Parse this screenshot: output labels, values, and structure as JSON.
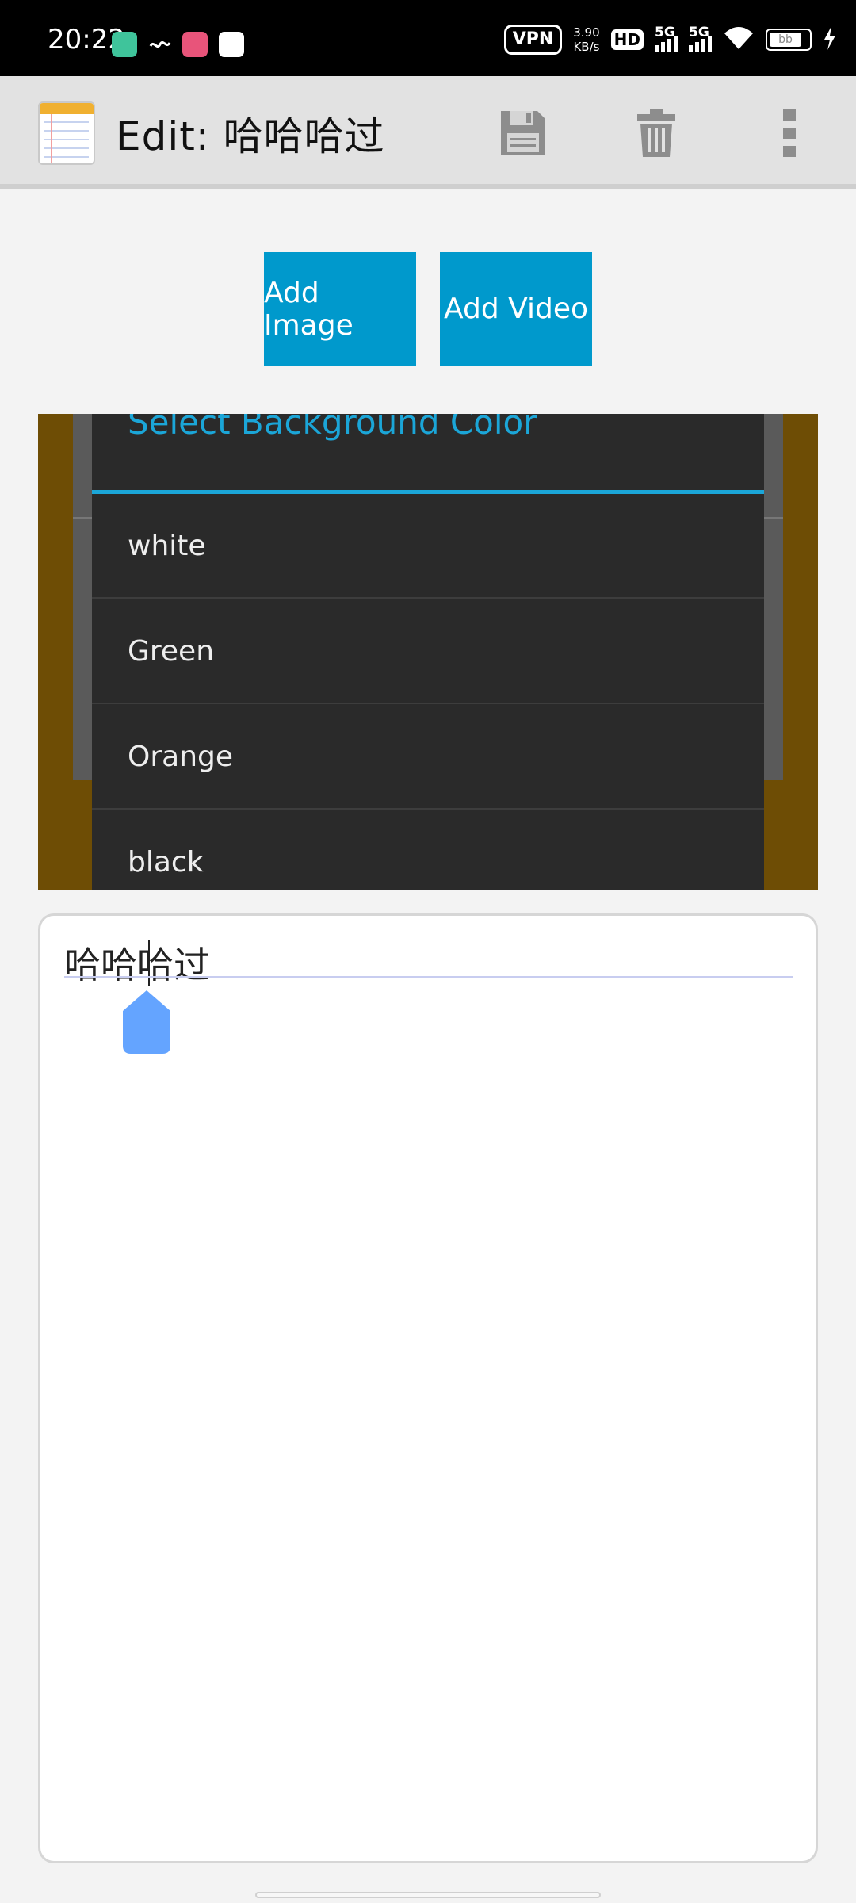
{
  "status_bar": {
    "time": "20:22",
    "vpn": "VPN",
    "net_speed_value": "3.90",
    "net_speed_unit": "KB/s",
    "hd": "HD",
    "sim1_label": "5G",
    "sim2_label": "5G",
    "battery_text": "bb"
  },
  "action_bar": {
    "title": "Edit: 哈哈哈过",
    "save_icon": "save-icon",
    "delete_icon": "trash-icon",
    "overflow_icon": "more-vert-icon"
  },
  "buttons": {
    "add_image": "Add Image",
    "add_video": "Add Video"
  },
  "dialog": {
    "title": "Select Background Color",
    "accent_color": "#1ba6d8",
    "options": [
      "white",
      "Green",
      "Orange",
      "black"
    ]
  },
  "editor": {
    "text": "哈哈哈过"
  }
}
